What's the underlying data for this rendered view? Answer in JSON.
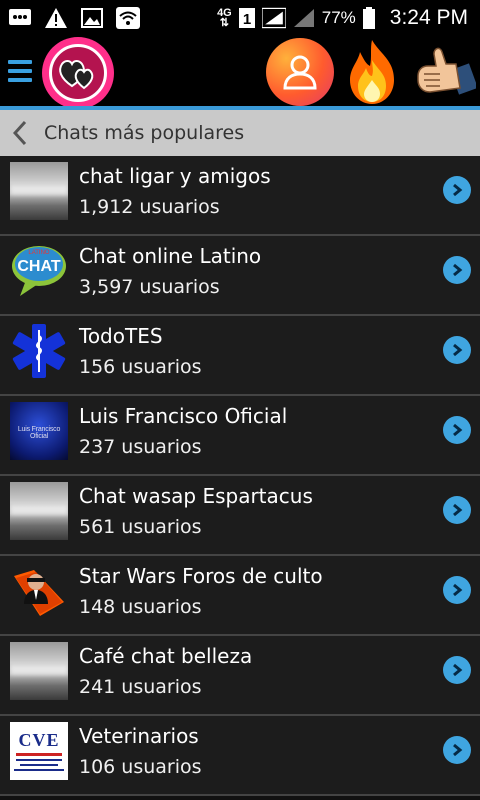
{
  "status_bar": {
    "network_type": "4G",
    "sim_slot": "1",
    "battery": "77%",
    "time": "3:24 PM"
  },
  "header": {
    "title": "Chats más populares"
  },
  "chats": [
    {
      "name": "chat ligar y amigos",
      "count": "1,912 usuarios",
      "thumb": "sky"
    },
    {
      "name": "Chat online Latino",
      "count": "3,597 usuarios",
      "thumb": "chat-bubble"
    },
    {
      "name": "TodoTES",
      "count": "156 usuarios",
      "thumb": "star-of-life"
    },
    {
      "name": "Luis Francisco Oficial",
      "count": "237 usuarios",
      "thumb": "blue-logo",
      "thumb_text": "Luis Francisco Oficial"
    },
    {
      "name": "Chat wasap Espartacus",
      "count": "561 usuarios",
      "thumb": "sky"
    },
    {
      "name": "Star Wars Foros de culto",
      "count": "148 usuarios",
      "thumb": "folder-man"
    },
    {
      "name": "Café chat belleza",
      "count": "241 usuarios",
      "thumb": "sky"
    },
    {
      "name": "Veterinarios",
      "count": "106 usuarios",
      "thumb": "cve-logo",
      "thumb_text": "CVE"
    }
  ],
  "colors": {
    "accent": "#3a9ad8",
    "go_button": "#3fa5e0",
    "logo_pink": "#ff2f8a",
    "header_bg": "#c9c9c9",
    "list_bg": "#1c1c1c"
  }
}
